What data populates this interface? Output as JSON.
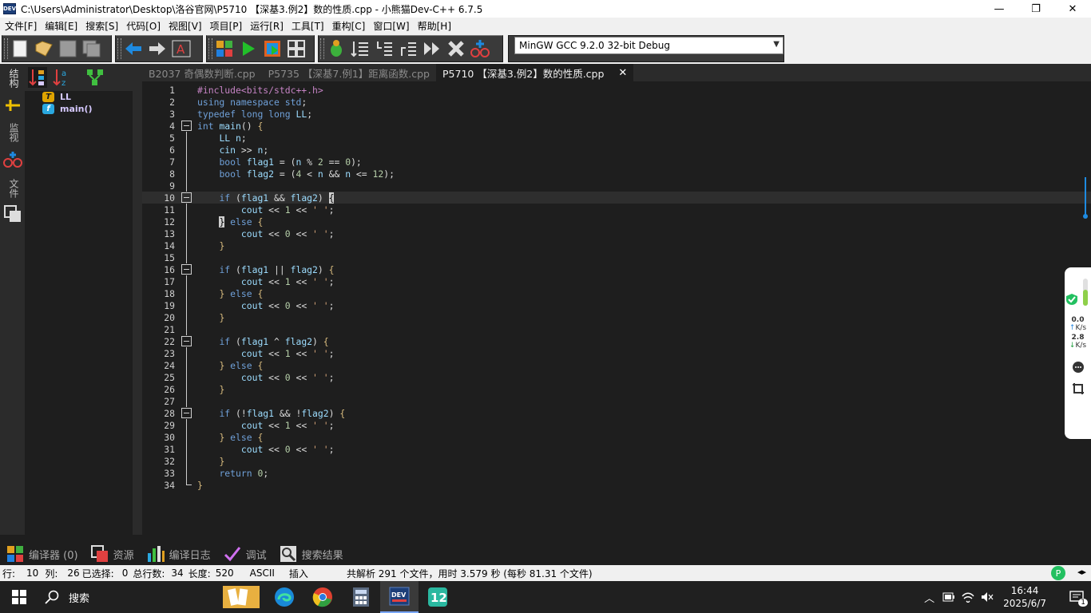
{
  "window": {
    "app_icon": "DEV",
    "title": "C:\\Users\\Administrator\\Desktop\\洛谷官网\\P5710 【深基3.例2】数的性质.cpp - 小熊猫Dev-C++ 6.7.5",
    "minimize": "—",
    "maximize": "❐",
    "close": "✕"
  },
  "menu": [
    "文件[F]",
    "编辑[E]",
    "搜索[S]",
    "代码[O]",
    "视图[V]",
    "项目[P]",
    "运行[R]",
    "工具[T]",
    "重构[C]",
    "窗口[W]",
    "帮助[H]"
  ],
  "compiler": {
    "selected": "MinGW GCC 9.2.0 32-bit Debug"
  },
  "left_strip": {
    "tab_structure": "结构",
    "tab_watch": "监视",
    "tab_files": "文件"
  },
  "structure": {
    "items": [
      {
        "badge": "T",
        "name": "LL",
        "color": "#e0a400"
      },
      {
        "badge": "f",
        "name": "main()",
        "color": "#2aa8e0"
      }
    ]
  },
  "tabs": [
    {
      "label": "B2037 奇偶数判断.cpp",
      "active": false
    },
    {
      "label": "P5735 【深基7.例1】距离函数.cpp",
      "active": false
    },
    {
      "label": "P5710 【深基3.例2】数的性质.cpp",
      "active": true,
      "close": "✕"
    }
  ],
  "code_lines": [
    "#include<bits/stdc++.h>",
    "using namespace std;",
    "typedef long long LL;",
    "int main() {",
    "    LL n;",
    "    cin >> n;",
    "    bool flag1 = (n % 2 == 0);",
    "    bool flag2 = (4 < n && n <= 12);",
    "",
    "    if (flag1 && flag2) {",
    "        cout << 1 << ' ';",
    "    } else {",
    "        cout << 0 << ' ';",
    "    }",
    "",
    "    if (flag1 || flag2) {",
    "        cout << 1 << ' ';",
    "    } else {",
    "        cout << 0 << ' ';",
    "    }",
    "",
    "    if (flag1 ^ flag2) {",
    "        cout << 1 << ' ';",
    "    } else {",
    "        cout << 0 << ' ';",
    "    }",
    "",
    "    if (!flag1 && !flag2) {",
    "        cout << 1 << ' ';",
    "    } else {",
    "        cout << 0 << ' ';",
    "    }",
    "    return 0;",
    "}"
  ],
  "current_line": 10,
  "bottom_tabs": [
    "编译器 (0)",
    "资源",
    "编译日志",
    "调试",
    "搜索结果"
  ],
  "status": {
    "line_label": "行:",
    "line_value": "10",
    "col_label": "列:",
    "col_value": "26",
    "selected_label": "已选择:",
    "selected_value": "0",
    "total_label": "总行数:",
    "total_value": "34",
    "length_label": "长度:",
    "length_value": "520",
    "encoding": "ASCII",
    "mode": "插入",
    "message": "共解析 291 个文件，用时 3.579 秒 (每秒 81.31 个文件)"
  },
  "side_widget": {
    "up_speed": "0.0",
    "up_unit": "K/s",
    "down_speed": "2.8",
    "down_unit": "K/s"
  },
  "taskbar": {
    "search_placeholder": "搜索",
    "time": "16:44",
    "date": "2025/6/7",
    "notification_count": "1"
  }
}
